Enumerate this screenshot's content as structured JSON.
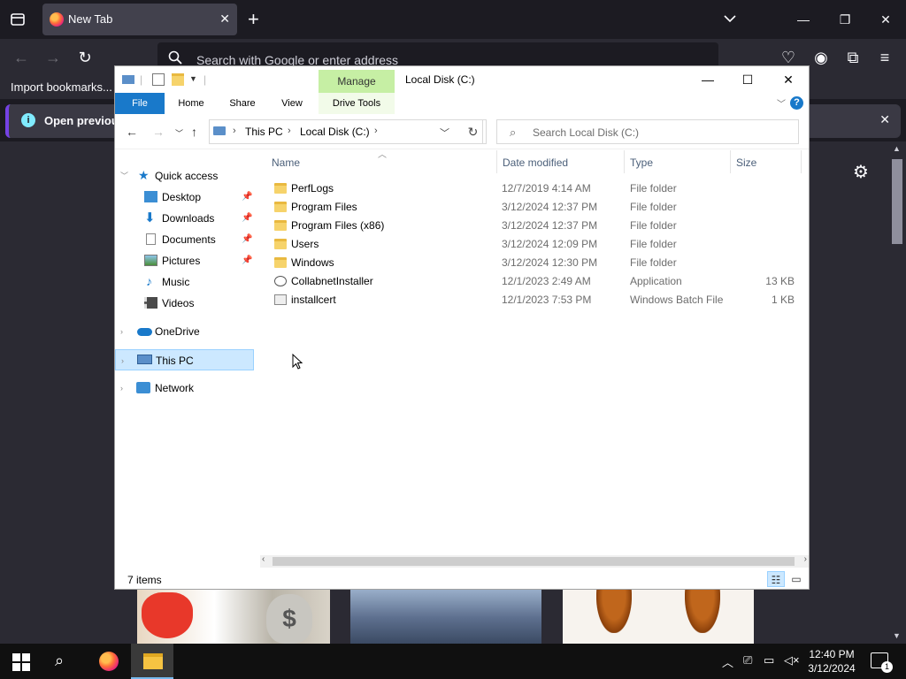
{
  "browser": {
    "tab_title": "New Tab",
    "close_tab": "✕",
    "new_tab": "+",
    "url_placeholder": "Search with Google or enter address",
    "bookmark_import": "Import bookmarks...",
    "notice_text": "Open previous tabs?",
    "colors": {
      "chrome": "#2b2a33",
      "accent": "#7542e5"
    }
  },
  "explorer": {
    "title": "Local Disk (C:)",
    "manage_tab": "Manage",
    "ribbon_tabs": [
      "File",
      "Home",
      "Share",
      "View",
      "Drive Tools"
    ],
    "help": "?",
    "address": {
      "segments": [
        "This PC",
        "Local Disk (C:)"
      ]
    },
    "search_placeholder": "Search Local Disk (C:)",
    "nav_pane": {
      "quick_access": "Quick access",
      "items": [
        "Desktop",
        "Downloads",
        "Documents",
        "Pictures",
        "Music",
        "Videos"
      ],
      "onedrive": "OneDrive",
      "this_pc": "This PC",
      "network": "Network"
    },
    "columns": [
      "Name",
      "Date modified",
      "Type",
      "Size"
    ],
    "files": [
      {
        "name": "PerfLogs",
        "date": "12/7/2019 4:14 AM",
        "type": "File folder",
        "size": "",
        "icon": "folder-icon"
      },
      {
        "name": "Program Files",
        "date": "3/12/2024 12:37 PM",
        "type": "File folder",
        "size": "",
        "icon": "folder-icon"
      },
      {
        "name": "Program Files (x86)",
        "date": "3/12/2024 12:37 PM",
        "type": "File folder",
        "size": "",
        "icon": "folder-icon"
      },
      {
        "name": "Users",
        "date": "3/12/2024 12:09 PM",
        "type": "File folder",
        "size": "",
        "icon": "folder-icon"
      },
      {
        "name": "Windows",
        "date": "3/12/2024 12:30 PM",
        "type": "File folder",
        "size": "",
        "icon": "folder-icon"
      },
      {
        "name": "CollabnetInstaller",
        "date": "12/1/2023 2:49 AM",
        "type": "Application",
        "size": "13 KB",
        "icon": "application-icon"
      },
      {
        "name": "installcert",
        "date": "12/1/2023 7:53 PM",
        "type": "Windows Batch File",
        "size": "1 KB",
        "icon": "batch-file-icon"
      }
    ],
    "status": "7 items"
  },
  "taskbar": {
    "time": "12:40 PM",
    "date": "3/12/2024",
    "notification_count": "1"
  }
}
